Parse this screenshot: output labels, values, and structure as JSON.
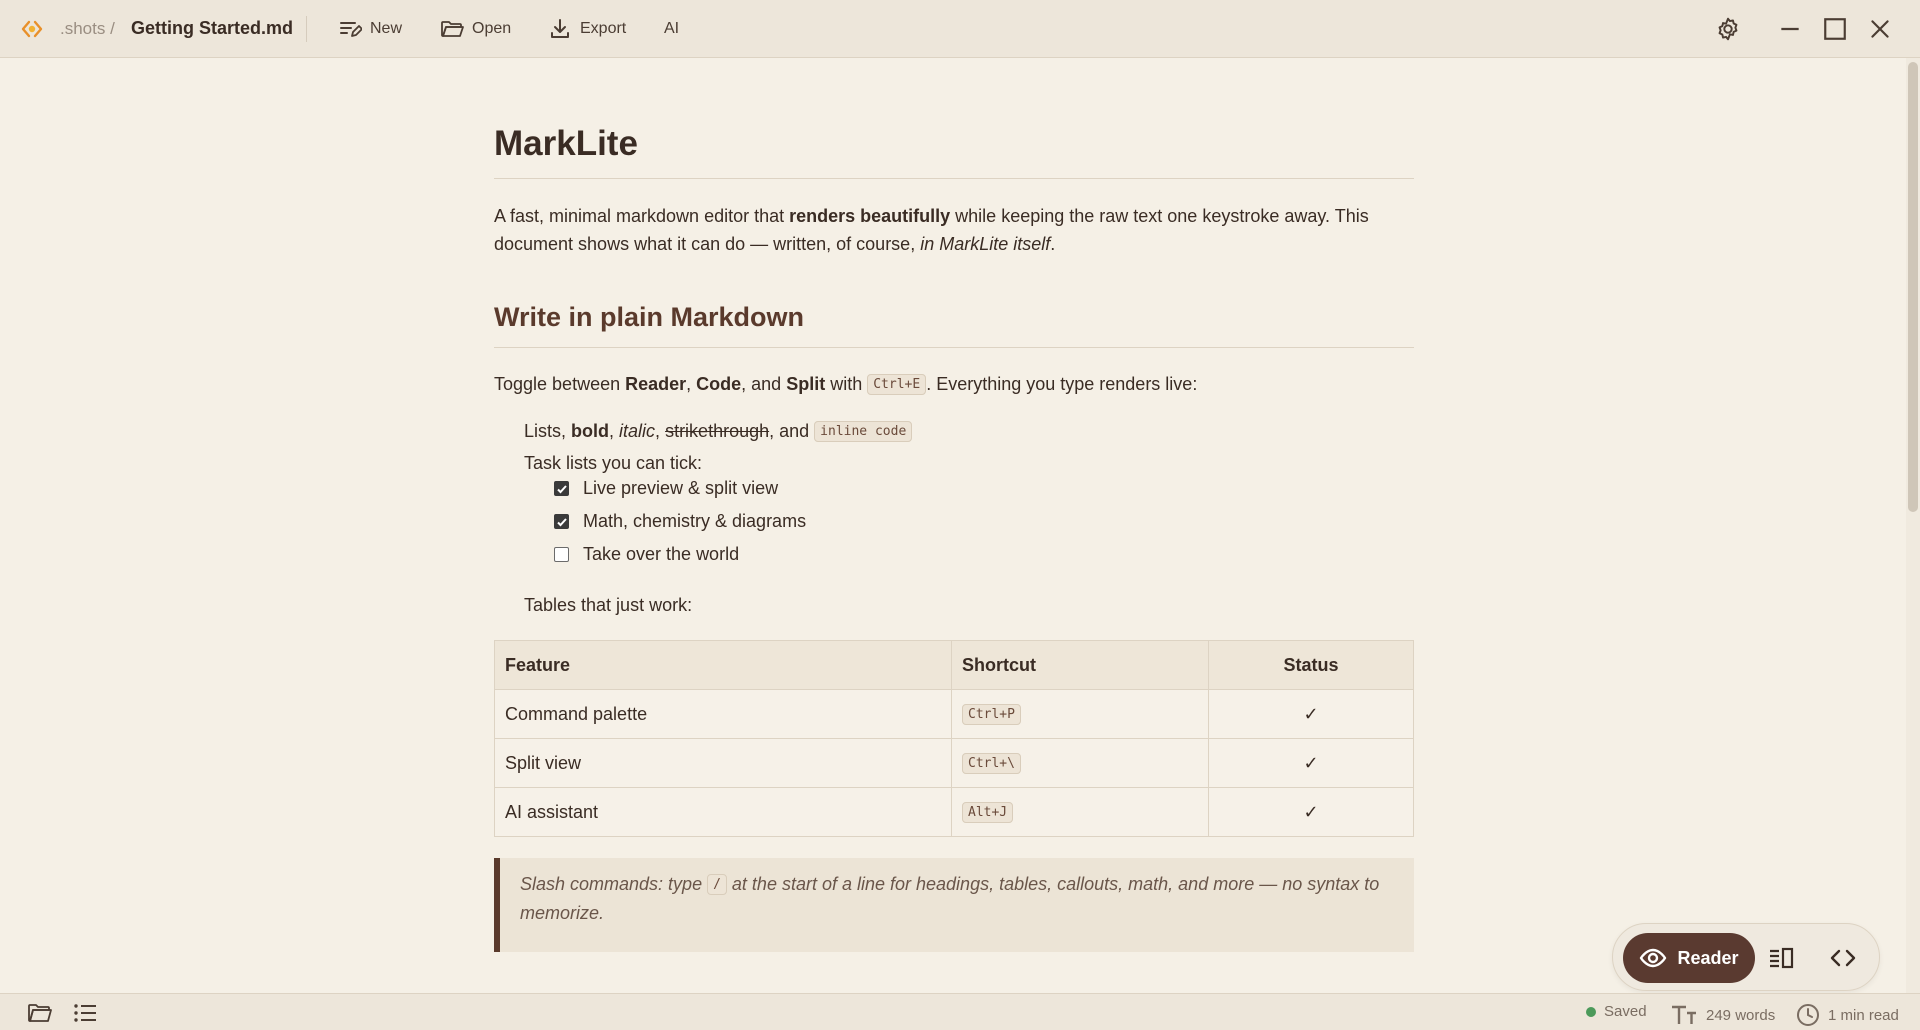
{
  "titlebar": {
    "crumb_parent": ".shots /",
    "crumb_file": "Getting Started.md",
    "buttons": {
      "new": "New",
      "open": "Open",
      "export": "Export",
      "ai": "AI"
    }
  },
  "doc": {
    "title": "MarkLite",
    "intro": {
      "part1": "A fast, minimal markdown editor that ",
      "bold": "renders beautifully",
      "part2": " while keeping the raw text one keystroke away. This document shows what it can do — written, of course, ",
      "italic": "in MarkLite itself",
      "part3": "."
    },
    "section_title": "Write in plain Markdown",
    "toggle": {
      "prefix": "Toggle between ",
      "reader": "Reader",
      "sep1": ", ",
      "code": "Code",
      "sep2": ", and ",
      "split": "Split",
      "with": " with ",
      "kbd": "Ctrl+E",
      "suffix": ". Everything you type renders live:"
    },
    "list": {
      "prefix": "Lists, ",
      "bold": "bold",
      "sep1": ", ",
      "italic": "italic",
      "sep2": ", ",
      "strike": "strikethrough",
      "sep3": ", and ",
      "code": "inline code"
    },
    "tasks_label": "Task lists you can tick:",
    "tasks": [
      {
        "label": "Live preview & split view",
        "checked": true
      },
      {
        "label": "Math, chemistry & diagrams",
        "checked": true
      },
      {
        "label": "Take over the world",
        "checked": false
      }
    ],
    "tables_label": "Tables that just work:",
    "table": {
      "headers": [
        "Feature",
        "Shortcut",
        "Status"
      ],
      "rows": [
        {
          "feature": "Command palette",
          "shortcut": "Ctrl+P",
          "status": "✓"
        },
        {
          "feature": "Split view",
          "shortcut": "Ctrl+\\",
          "status": "✓"
        },
        {
          "feature": "AI assistant",
          "shortcut": "Alt+J",
          "status": "✓"
        }
      ]
    },
    "quote": {
      "part1": "Slash commands: type ",
      "kbd": "/",
      "part2": " at the start of a line for headings, tables, callouts, math, and more — no syntax to memorize."
    }
  },
  "switcher": {
    "reader_label": "Reader"
  },
  "statusbar": {
    "saved": "Saved",
    "words": "249 words",
    "read_time": "1 min read"
  },
  "colors": {
    "accent": "#5a3a30",
    "background": "#f5f0e6",
    "saved_dot": "#4c9a5a"
  }
}
